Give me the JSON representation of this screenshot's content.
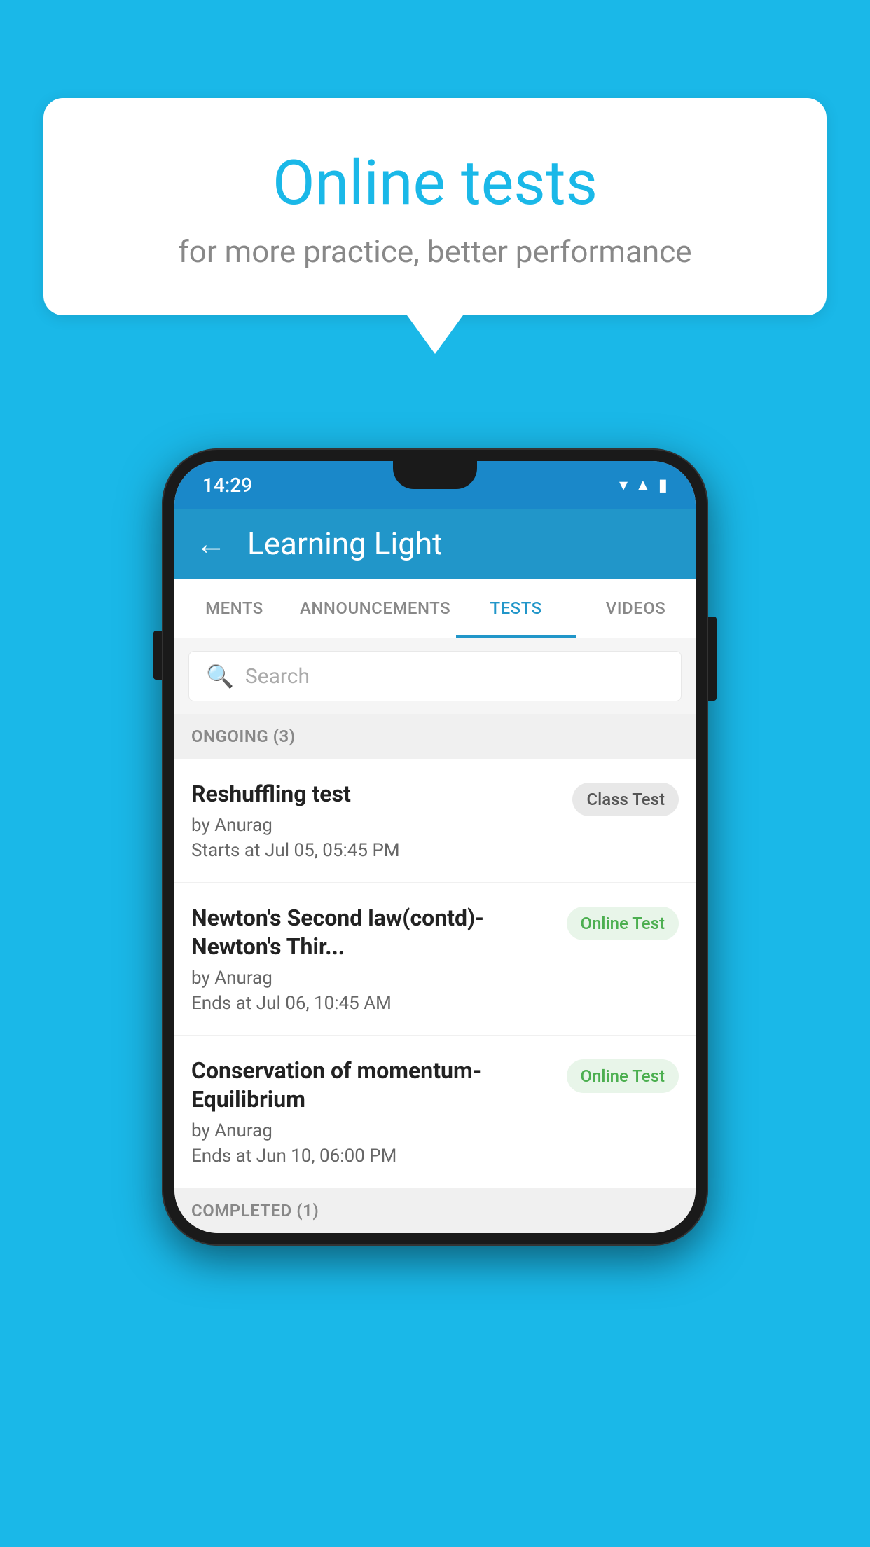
{
  "background": {
    "color": "#1ab8e8"
  },
  "speech_bubble": {
    "title": "Online tests",
    "subtitle": "for more practice, better performance"
  },
  "phone": {
    "status_bar": {
      "time": "14:29",
      "icons": [
        "wifi",
        "signal",
        "battery"
      ]
    },
    "app_header": {
      "back_label": "←",
      "title": "Learning Light"
    },
    "tabs": [
      {
        "label": "MENTS",
        "active": false
      },
      {
        "label": "ANNOUNCEMENTS",
        "active": false
      },
      {
        "label": "TESTS",
        "active": true
      },
      {
        "label": "VIDEOS",
        "active": false
      }
    ],
    "search": {
      "placeholder": "Search"
    },
    "ongoing_section": {
      "title": "ONGOING (3)"
    },
    "tests": [
      {
        "name": "Reshuffling test",
        "by": "by Anurag",
        "time_label": "Starts at",
        "time": "Jul 05, 05:45 PM",
        "badge": "Class Test",
        "badge_type": "class"
      },
      {
        "name": "Newton's Second law(contd)-Newton's Thir...",
        "by": "by Anurag",
        "time_label": "Ends at",
        "time": "Jul 06, 10:45 AM",
        "badge": "Online Test",
        "badge_type": "online"
      },
      {
        "name": "Conservation of momentum-Equilibrium",
        "by": "by Anurag",
        "time_label": "Ends at",
        "time": "Jun 10, 06:00 PM",
        "badge": "Online Test",
        "badge_type": "online"
      }
    ],
    "completed_section": {
      "title": "COMPLETED (1)"
    }
  }
}
